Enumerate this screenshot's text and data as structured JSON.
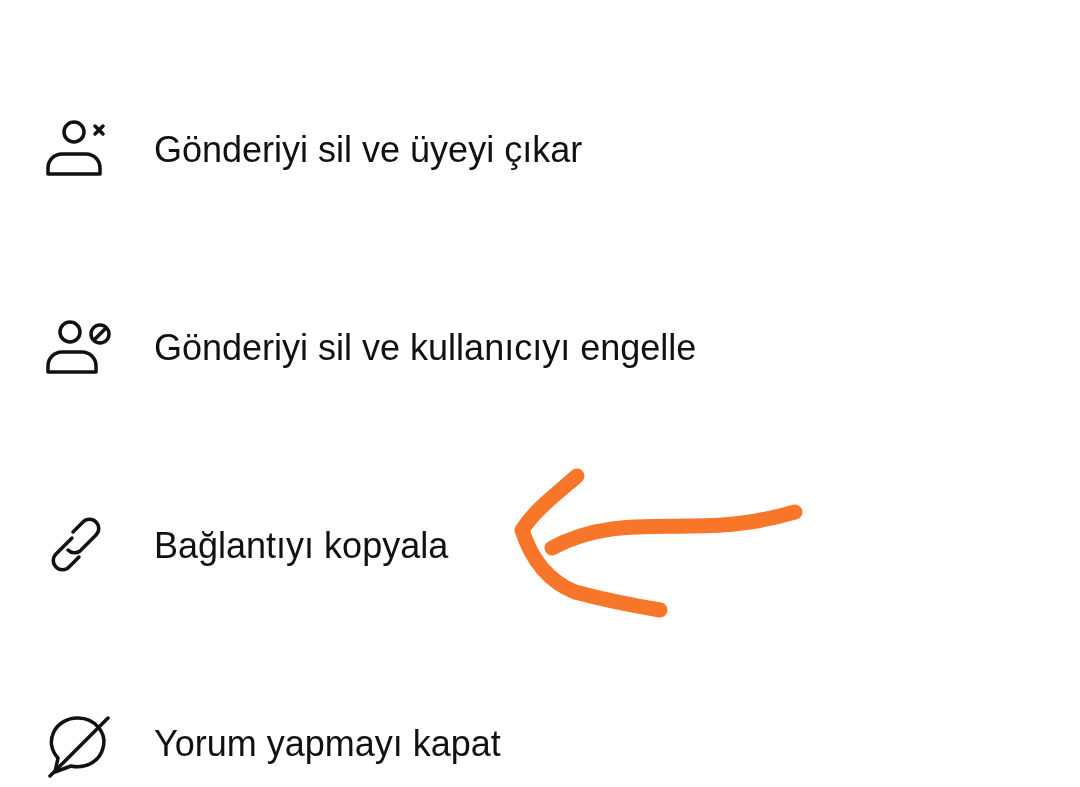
{
  "menu": {
    "items": [
      {
        "kind": "remove-member",
        "label": "Gönderiyi sil ve üyeyi çıkar"
      },
      {
        "kind": "block-user",
        "label": "Gönderiyi sil ve kullanıcıyı engelle"
      },
      {
        "kind": "copy-link",
        "label": "Bağlantıyı kopyala"
      },
      {
        "kind": "disable-comments",
        "label": "Yorum yapmayı kapat"
      }
    ]
  }
}
